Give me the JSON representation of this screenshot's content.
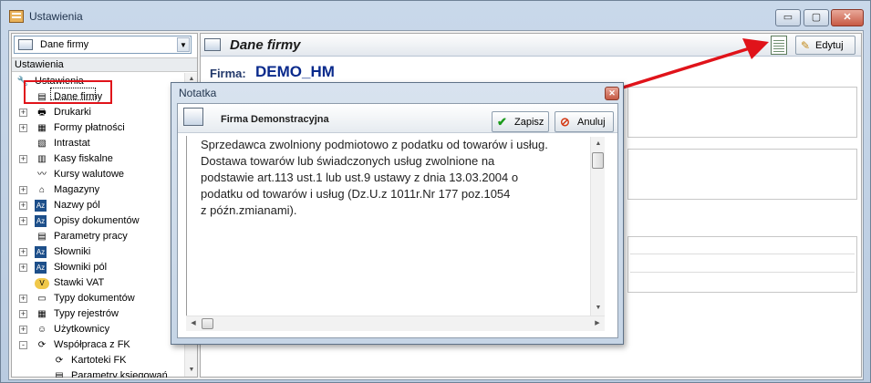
{
  "window": {
    "title": "Ustawienia",
    "minimize_icon": "minimize-icon",
    "maximize_icon": "maximize-icon",
    "close_icon": "close-icon"
  },
  "left_panel": {
    "combo_value": "Dane firmy",
    "header": "Ustawienia",
    "tree": [
      {
        "label": "Ustawienia",
        "icon": "tools-icon",
        "expander": "",
        "level": 0
      },
      {
        "label": "Dane firmy",
        "icon": "company-card-icon",
        "expander": "",
        "level": 1,
        "selected": true
      },
      {
        "label": "Drukarki",
        "icon": "printer-icon",
        "expander": "+",
        "level": 1
      },
      {
        "label": "Formy płatności",
        "icon": "payment-icon",
        "expander": "+",
        "level": 1
      },
      {
        "label": "Intrastat",
        "icon": "document-icon",
        "expander": "",
        "level": 1
      },
      {
        "label": "Kasy fiskalne",
        "icon": "cash-register-icon",
        "expander": "+",
        "level": 1
      },
      {
        "label": "Kursy walutowe",
        "icon": "chart-icon",
        "expander": "",
        "level": 1
      },
      {
        "label": "Magazyny",
        "icon": "warehouse-icon",
        "expander": "+",
        "level": 1
      },
      {
        "label": "Nazwy pól",
        "icon": "az-icon",
        "expander": "+",
        "level": 1
      },
      {
        "label": "Opisy dokumentów",
        "icon": "az-icon",
        "expander": "+",
        "level": 1
      },
      {
        "label": "Parametry pracy",
        "icon": "parameters-icon",
        "expander": "",
        "level": 1
      },
      {
        "label": "Słowniki",
        "icon": "az-icon",
        "expander": "+",
        "level": 1
      },
      {
        "label": "Słowniki pól",
        "icon": "az-icon",
        "expander": "+",
        "level": 1
      },
      {
        "label": "Stawki VAT",
        "icon": "vat-icon",
        "expander": "",
        "level": 1
      },
      {
        "label": "Typy dokumentów",
        "icon": "folder-icon",
        "expander": "+",
        "level": 1
      },
      {
        "label": "Typy rejestrów",
        "icon": "register-icon",
        "expander": "+",
        "level": 1
      },
      {
        "label": "Użytkownicy",
        "icon": "users-icon",
        "expander": "+",
        "level": 1
      },
      {
        "label": "Współpraca z FK",
        "icon": "sync-icon",
        "expander": "-",
        "level": 1
      },
      {
        "label": "Kartoteki FK",
        "icon": "sync-icon",
        "expander": "",
        "level": 2
      },
      {
        "label": "Parametry księgowań",
        "icon": "parameters-icon",
        "expander": "",
        "level": 2
      }
    ]
  },
  "right_panel": {
    "title": "Dane firmy",
    "edit_label": "Edytuj",
    "firm_label": "Firma:",
    "firm_value": "DEMO_HM"
  },
  "dialog": {
    "title": "Notatka",
    "header_title": "Firma Demonstracyjna",
    "save_label": "Zapisz",
    "cancel_label": "Anuluj",
    "memo_lines": [
      "Sprzedawca zwolniony podmiotowo z podatku od towarów i usług.",
      "Dostawa towarów lub świadczonych usług zwolnione na",
      "podstawie art.113 ust.1 lub ust.9 ustawy z dnia 13.03.2004 o",
      "podatku od towarów i usług (Dz.U.z 1011r.Nr 177 poz.1054",
      "z późn.zmianami)."
    ]
  },
  "colors": {
    "annotation_red": "#e0131a",
    "firm_value_blue": "#0a2a8c"
  }
}
